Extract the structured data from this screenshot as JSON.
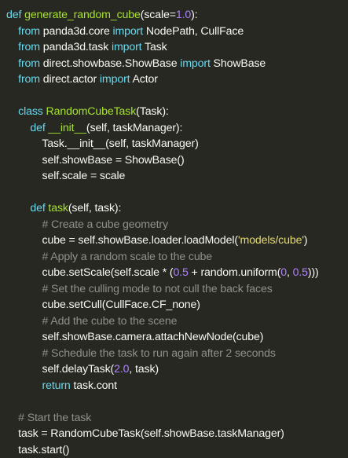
{
  "colors": {
    "background": "#272822",
    "default": "#f8f8f2",
    "keyword": "#66d9ef",
    "function": "#a6e22e",
    "number": "#ae81ff",
    "string": "#e6db74",
    "comment": "#90908a"
  },
  "code": {
    "lines": [
      {
        "indent": "",
        "tokens": [
          {
            "t": "kw",
            "v": "def "
          },
          {
            "t": "fn",
            "v": "generate_random_cube"
          },
          {
            "t": "op",
            "v": "(scale="
          },
          {
            "t": "num",
            "v": "1.0"
          },
          {
            "t": "op",
            "v": "):"
          }
        ]
      },
      {
        "indent": "    ",
        "tokens": [
          {
            "t": "kw",
            "v": "from "
          },
          {
            "t": "op",
            "v": "panda3d.core "
          },
          {
            "t": "kw",
            "v": "import "
          },
          {
            "t": "op",
            "v": "NodePath, CullFace"
          }
        ]
      },
      {
        "indent": "    ",
        "tokens": [
          {
            "t": "kw",
            "v": "from "
          },
          {
            "t": "op",
            "v": "panda3d.task "
          },
          {
            "t": "kw",
            "v": "import "
          },
          {
            "t": "op",
            "v": "Task"
          }
        ]
      },
      {
        "indent": "    ",
        "tokens": [
          {
            "t": "kw",
            "v": "from "
          },
          {
            "t": "op",
            "v": "direct.showbase.ShowBase "
          },
          {
            "t": "kw",
            "v": "import "
          },
          {
            "t": "op",
            "v": "ShowBase"
          }
        ]
      },
      {
        "indent": "    ",
        "tokens": [
          {
            "t": "kw",
            "v": "from "
          },
          {
            "t": "op",
            "v": "direct.actor "
          },
          {
            "t": "kw",
            "v": "import "
          },
          {
            "t": "op",
            "v": "Actor"
          }
        ]
      },
      {
        "indent": "",
        "tokens": []
      },
      {
        "indent": "    ",
        "tokens": [
          {
            "t": "kw",
            "v": "class "
          },
          {
            "t": "fn",
            "v": "RandomCubeTask"
          },
          {
            "t": "op",
            "v": "(Task):"
          }
        ]
      },
      {
        "indent": "        ",
        "tokens": [
          {
            "t": "kw",
            "v": "def "
          },
          {
            "t": "fn",
            "v": "__init__"
          },
          {
            "t": "op",
            "v": "(self, taskManager):"
          }
        ]
      },
      {
        "indent": "            ",
        "tokens": [
          {
            "t": "op",
            "v": "Task.__init__(self, taskManager)"
          }
        ]
      },
      {
        "indent": "            ",
        "tokens": [
          {
            "t": "op",
            "v": "self.showBase = ShowBase()"
          }
        ]
      },
      {
        "indent": "            ",
        "tokens": [
          {
            "t": "op",
            "v": "self.scale = scale"
          }
        ]
      },
      {
        "indent": "",
        "tokens": []
      },
      {
        "indent": "        ",
        "tokens": [
          {
            "t": "kw",
            "v": "def "
          },
          {
            "t": "fn",
            "v": "task"
          },
          {
            "t": "op",
            "v": "(self, task):"
          }
        ]
      },
      {
        "indent": "            ",
        "tokens": [
          {
            "t": "cm",
            "v": "# Create a cube geometry"
          }
        ]
      },
      {
        "indent": "            ",
        "tokens": [
          {
            "t": "op",
            "v": "cube = self.showBase.loader.loadModel("
          },
          {
            "t": "str",
            "v": "'models/cube'"
          },
          {
            "t": "op",
            "v": ")"
          }
        ]
      },
      {
        "indent": "            ",
        "tokens": [
          {
            "t": "cm",
            "v": "# Apply a random scale to the cube"
          }
        ]
      },
      {
        "indent": "            ",
        "tokens": [
          {
            "t": "op",
            "v": "cube.setScale(self.scale * ("
          },
          {
            "t": "num",
            "v": "0.5"
          },
          {
            "t": "op",
            "v": " + random.uniform("
          },
          {
            "t": "num",
            "v": "0"
          },
          {
            "t": "op",
            "v": ", "
          },
          {
            "t": "num",
            "v": "0.5"
          },
          {
            "t": "op",
            "v": ")))"
          }
        ]
      },
      {
        "indent": "            ",
        "tokens": [
          {
            "t": "cm",
            "v": "# Set the culling mode to not cull the back faces"
          }
        ]
      },
      {
        "indent": "            ",
        "tokens": [
          {
            "t": "op",
            "v": "cube.setCull(CullFace.CF_none)"
          }
        ]
      },
      {
        "indent": "            ",
        "tokens": [
          {
            "t": "cm",
            "v": "# Add the cube to the scene"
          }
        ]
      },
      {
        "indent": "            ",
        "tokens": [
          {
            "t": "op",
            "v": "self.showBase.camera.attachNewNode(cube)"
          }
        ]
      },
      {
        "indent": "            ",
        "tokens": [
          {
            "t": "cm",
            "v": "# Schedule the task to run again after 2 seconds"
          }
        ]
      },
      {
        "indent": "            ",
        "tokens": [
          {
            "t": "op",
            "v": "self.delayTask("
          },
          {
            "t": "num",
            "v": "2.0"
          },
          {
            "t": "op",
            "v": ", task)"
          }
        ]
      },
      {
        "indent": "            ",
        "tokens": [
          {
            "t": "kw",
            "v": "return "
          },
          {
            "t": "op",
            "v": "task.cont"
          }
        ]
      },
      {
        "indent": "",
        "tokens": []
      },
      {
        "indent": "    ",
        "tokens": [
          {
            "t": "cm",
            "v": "# Start the task"
          }
        ]
      },
      {
        "indent": "    ",
        "tokens": [
          {
            "t": "op",
            "v": "task = RandomCubeTask(self.showBase.taskManager)"
          }
        ]
      },
      {
        "indent": "    ",
        "tokens": [
          {
            "t": "op",
            "v": "task.start()"
          }
        ]
      }
    ]
  }
}
